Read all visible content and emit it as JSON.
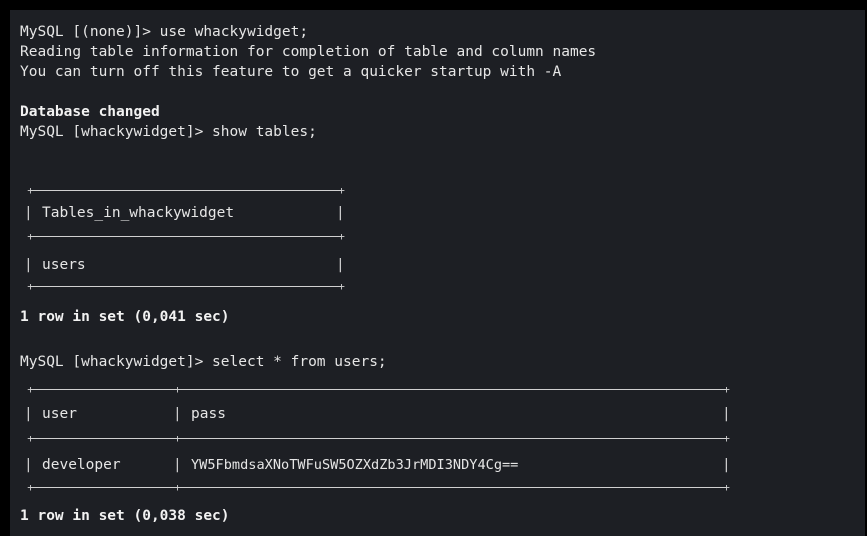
{
  "terminal": {
    "lines": {
      "l1": "MySQL [(none)]> use whackywidget;",
      "l2": "Reading table information for completion of table and column names",
      "l3": "You can turn off this feature to get a quicker startup with -A",
      "l4": "Database changed",
      "l5": "MySQL [whackywidget]> show tables;",
      "l6": "1 row in set (0,041 sec)",
      "l7": "MySQL [whackywidget]> select * from users;",
      "l8": "1 row in set (0,038 sec)"
    },
    "tables_result": {
      "header": "Tables_in_whackywidget",
      "rows": [
        "users"
      ]
    },
    "users_result": {
      "columns": [
        "user",
        "pass"
      ],
      "rows": [
        {
          "user": "developer",
          "pass": "YW5FbmdsaXNoTWFuSW5OZXdZb3JrMDI3NDY4Cg=="
        }
      ]
    }
  }
}
